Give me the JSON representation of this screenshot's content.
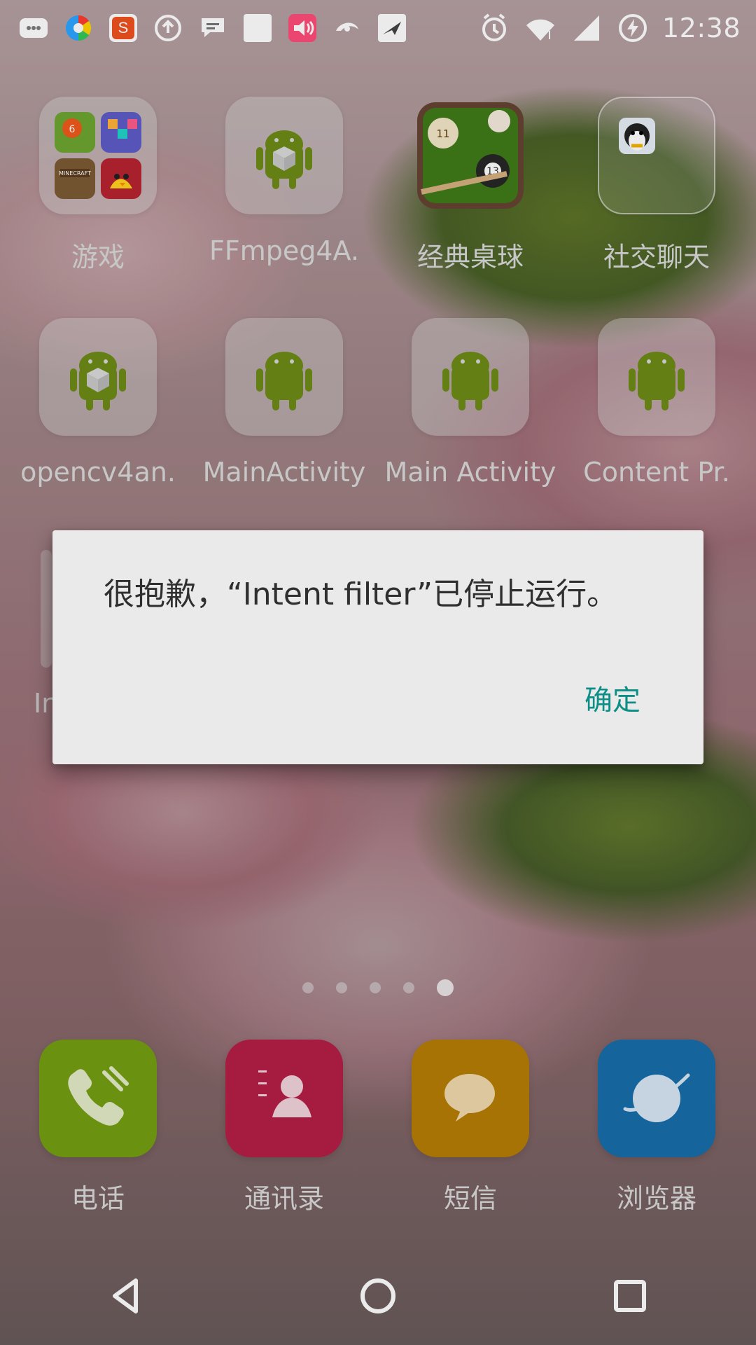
{
  "status_bar": {
    "time": "12:38",
    "icons": [
      "message-icon",
      "color-wheel-icon",
      "sogou-icon",
      "upload-icon",
      "chat-icon",
      "white-square-icon",
      "speaker-icon",
      "swirl-icon",
      "bird-icon",
      "alarm-icon",
      "wifi-icon",
      "signal-icon",
      "battery-charging-icon"
    ]
  },
  "apps": [
    {
      "label": "游戏",
      "icon": "folder-games-icon"
    },
    {
      "label": "FFmpeg4A.",
      "icon": "android-box-icon"
    },
    {
      "label": "经典桌球",
      "icon": "billiards-icon"
    },
    {
      "label": "社交聊天",
      "icon": "qq-folder-icon"
    },
    {
      "label": "opencv4an.",
      "icon": "android-box-icon"
    },
    {
      "label": "MainActivity",
      "icon": "android-icon"
    },
    {
      "label": "Main Activity",
      "icon": "android-icon"
    },
    {
      "label": "Content Pr.",
      "icon": "android-icon"
    }
  ],
  "partial_label": "In",
  "dialog": {
    "message": "很抱歉，“Intent filter”已停止运行。",
    "ok_button": "确定"
  },
  "page_dots": {
    "count": 5,
    "active_index": 4
  },
  "dock": [
    {
      "label": "电话",
      "icon": "phone-icon",
      "color": "#9ad41e"
    },
    {
      "label": "通讯录",
      "icon": "contacts-icon",
      "color": "#ff2d61"
    },
    {
      "label": "短信",
      "icon": "messages-icon",
      "color": "#ffb400"
    },
    {
      "label": "浏览器",
      "icon": "browser-icon",
      "color": "#1ea6ff"
    }
  ],
  "nav": {
    "back": "back-icon",
    "home": "home-icon",
    "recents": "recents-icon"
  }
}
